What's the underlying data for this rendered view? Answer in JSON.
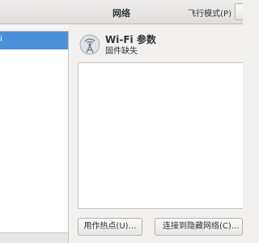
{
  "header": {
    "title": "网络",
    "airplane_mode_label": "飞行模式(P)"
  },
  "sidebar": {
    "selected_item_label": "i"
  },
  "device": {
    "name": "Wi-Fi 参数",
    "status": "固件缺失",
    "icon": "wifi-antenna-icon"
  },
  "buttons": {
    "hotspot": "用作热点(U)…",
    "hidden_network": "连接到隐藏网络(C)…"
  }
}
